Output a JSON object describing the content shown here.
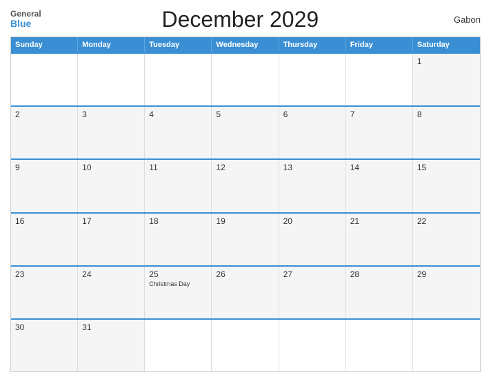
{
  "header": {
    "logo_general": "General",
    "logo_blue": "Blue",
    "title": "December 2029",
    "country": "Gabon"
  },
  "weekdays": [
    "Sunday",
    "Monday",
    "Tuesday",
    "Wednesday",
    "Thursday",
    "Friday",
    "Saturday"
  ],
  "rows": [
    [
      {
        "day": "",
        "empty": true
      },
      {
        "day": "",
        "empty": true
      },
      {
        "day": "",
        "empty": true
      },
      {
        "day": "",
        "empty": true
      },
      {
        "day": "",
        "empty": true
      },
      {
        "day": "",
        "empty": true
      },
      {
        "day": "1"
      }
    ],
    [
      {
        "day": "2"
      },
      {
        "day": "3"
      },
      {
        "day": "4"
      },
      {
        "day": "5"
      },
      {
        "day": "6"
      },
      {
        "day": "7"
      },
      {
        "day": "8"
      }
    ],
    [
      {
        "day": "9"
      },
      {
        "day": "10"
      },
      {
        "day": "11"
      },
      {
        "day": "12"
      },
      {
        "day": "13"
      },
      {
        "day": "14"
      },
      {
        "day": "15"
      }
    ],
    [
      {
        "day": "16"
      },
      {
        "day": "17"
      },
      {
        "day": "18"
      },
      {
        "day": "19"
      },
      {
        "day": "20"
      },
      {
        "day": "21"
      },
      {
        "day": "22"
      }
    ],
    [
      {
        "day": "23"
      },
      {
        "day": "24"
      },
      {
        "day": "25",
        "event": "Christmas Day"
      },
      {
        "day": "26"
      },
      {
        "day": "27"
      },
      {
        "day": "28"
      },
      {
        "day": "29"
      }
    ],
    [
      {
        "day": "30"
      },
      {
        "day": "31"
      },
      {
        "day": "",
        "empty": true
      },
      {
        "day": "",
        "empty": true
      },
      {
        "day": "",
        "empty": true
      },
      {
        "day": "",
        "empty": true
      },
      {
        "day": "",
        "empty": true
      }
    ]
  ]
}
